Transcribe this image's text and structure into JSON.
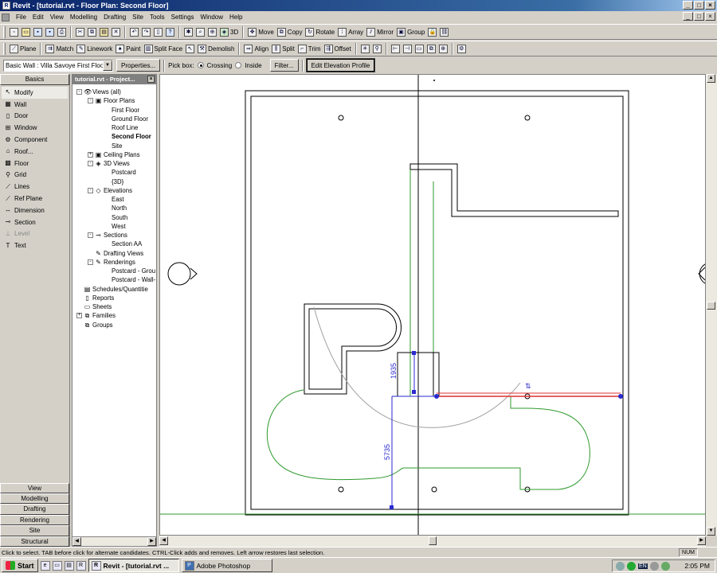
{
  "window": {
    "title": "Revit - [tutorial.rvt - Floor Plan: Second Floor]",
    "minimize": "_",
    "maximize": "□",
    "close": "×"
  },
  "menu": [
    "File",
    "Edit",
    "View",
    "Modelling",
    "Drafting",
    "Site",
    "Tools",
    "Settings",
    "Window",
    "Help"
  ],
  "toolbar1": [
    {
      "icon": "new-icon",
      "glyph": "▫"
    },
    {
      "icon": "open-icon",
      "glyph": "▭"
    },
    {
      "icon": "save-icon",
      "glyph": "▪"
    },
    {
      "icon": "save-as-icon",
      "glyph": "▪"
    },
    {
      "icon": "print-icon",
      "glyph": "⎙"
    },
    {
      "icon": "cut-icon",
      "glyph": "✂"
    },
    {
      "icon": "copy-icon",
      "glyph": "⧉"
    },
    {
      "icon": "paste-icon",
      "glyph": "▤"
    },
    {
      "icon": "delete-icon",
      "glyph": "✕"
    },
    {
      "icon": "undo-icon",
      "glyph": "↶"
    },
    {
      "icon": "redo-icon",
      "glyph": "↷"
    },
    {
      "icon": "thin-lines-icon",
      "glyph": "▯"
    },
    {
      "icon": "help-icon",
      "glyph": "?"
    },
    {
      "icon": "orbit-icon",
      "glyph": "✱"
    },
    {
      "icon": "zoom-icon",
      "glyph": "⌕"
    },
    {
      "icon": "zoom-region-icon",
      "glyph": "⊕"
    },
    {
      "icon": "3d-view-icon",
      "glyph": "◈"
    }
  ],
  "toolbar1_labels": {
    "threed": "3D",
    "move": "Move",
    "copy": "Copy",
    "rotate": "Rotate",
    "array": "Array",
    "mirror": "Mirror",
    "group": "Group"
  },
  "toolbar2": {
    "plane": "Plane",
    "match": "Match",
    "linework": "Linework",
    "paint": "Paint",
    "split_face": "Split Face",
    "demolish": "Demolish",
    "align": "Align",
    "split": "Split",
    "trim": "Trim",
    "offset": "Offset"
  },
  "options": {
    "type_selector": "Basic Wall : Villa Savoye First Floor",
    "properties": "Properties...",
    "pick_box": "Pick box:",
    "crossing": "Crossing",
    "inside": "Inside",
    "filter": "Filter...",
    "edit_profile": "Edit Elevation Profile"
  },
  "design_bar": {
    "title": "Basics",
    "items": [
      {
        "label": "Modify",
        "icon": "arrow-icon",
        "glyph": "↖",
        "selected": true
      },
      {
        "label": "Wall",
        "icon": "wall-icon",
        "glyph": "▦"
      },
      {
        "label": "Door",
        "icon": "door-icon",
        "glyph": "▯"
      },
      {
        "label": "Window",
        "icon": "window-icon",
        "glyph": "⊞"
      },
      {
        "label": "Component",
        "icon": "component-icon",
        "glyph": "⚙"
      },
      {
        "label": "Roof...",
        "icon": "roof-icon",
        "glyph": "⌂"
      },
      {
        "label": "Floor",
        "icon": "floor-icon",
        "glyph": "▩"
      },
      {
        "label": "Grid",
        "icon": "grid-icon",
        "glyph": "⚲"
      },
      {
        "label": "Lines",
        "icon": "lines-icon",
        "glyph": "⟋"
      },
      {
        "label": "Ref Plane",
        "icon": "ref-plane-icon",
        "glyph": "⟋"
      },
      {
        "label": "Dimension",
        "icon": "dimension-icon",
        "glyph": "↔"
      },
      {
        "label": "Section",
        "icon": "section-icon",
        "glyph": "⊸"
      },
      {
        "label": "Level",
        "icon": "level-icon",
        "glyph": "⊥",
        "disabled": true
      },
      {
        "label": "Text",
        "icon": "text-icon",
        "glyph": "T"
      }
    ],
    "tabs": [
      "View",
      "Modelling",
      "Drafting",
      "Rendering",
      "Site",
      "Structural"
    ]
  },
  "project_browser": {
    "title": "tutorial.rvt - Project...",
    "close": "×",
    "nodes": [
      {
        "label": "Views (all)",
        "level": 0,
        "expander": "-",
        "icon": "eye-icon",
        "glyph": "👁"
      },
      {
        "label": "Floor Plans",
        "level": 1,
        "expander": "-",
        "icon": "floor-plan-icon",
        "glyph": "▣"
      },
      {
        "label": "First Floor",
        "level": 2
      },
      {
        "label": "Ground Floor",
        "level": 2
      },
      {
        "label": "Roof Line",
        "level": 2
      },
      {
        "label": "Second Floor",
        "level": 2,
        "bold": true
      },
      {
        "label": "Site",
        "level": 2
      },
      {
        "label": "Ceiling Plans",
        "level": 1,
        "expander": "+",
        "icon": "ceiling-plan-icon",
        "glyph": "▣"
      },
      {
        "label": "3D Views",
        "level": 1,
        "expander": "-",
        "icon": "3d-views-icon",
        "glyph": "◈"
      },
      {
        "label": "Postcard",
        "level": 2
      },
      {
        "label": "{3D}",
        "level": 2
      },
      {
        "label": "Elevations",
        "level": 1,
        "expander": "-",
        "icon": "elevation-icon",
        "glyph": "◇"
      },
      {
        "label": "East",
        "level": 2
      },
      {
        "label": "North",
        "level": 2
      },
      {
        "label": "South",
        "level": 2
      },
      {
        "label": "West",
        "level": 2
      },
      {
        "label": "Sections",
        "level": 1,
        "expander": "-",
        "icon": "sections-icon",
        "glyph": "⊸"
      },
      {
        "label": "Section AA",
        "level": 2
      },
      {
        "label": "Drafting Views",
        "level": 1,
        "icon": "drafting-icon",
        "glyph": "✎"
      },
      {
        "label": "Renderings",
        "level": 1,
        "expander": "-",
        "icon": "renderings-icon",
        "glyph": "✎"
      },
      {
        "label": "Postcard - Grou",
        "level": 2
      },
      {
        "label": "Postcard - Wall-",
        "level": 2
      },
      {
        "label": "Schedules/Quantitie",
        "level": 0,
        "icon": "schedule-icon",
        "glyph": "▤"
      },
      {
        "label": "Reports",
        "level": 0,
        "icon": "reports-icon",
        "glyph": "▯"
      },
      {
        "label": "Sheets",
        "level": 0,
        "icon": "sheets-icon",
        "glyph": "▭"
      },
      {
        "label": "Families",
        "level": 0,
        "expander": "+",
        "icon": "families-icon",
        "glyph": "⧉"
      },
      {
        "label": "Groups",
        "level": 0,
        "icon": "groups-icon",
        "glyph": "⧉"
      }
    ]
  },
  "canvas": {
    "dim_vertical_1": "1935",
    "dim_vertical_2": "5735",
    "accent_green": "#2e9a2e",
    "accent_red": "#e03030",
    "accent_blue": "#2a2ad0"
  },
  "status": {
    "text": "Click to select. TAB before click for alternate candidates. CTRL-Click adds and removes. Left arrow restores last selection.",
    "num": "NUM"
  },
  "taskbar": {
    "start": "Start",
    "tasks": [
      {
        "label": "Revit - [tutorial.rvt ...",
        "active": true
      },
      {
        "label": "Adobe Photoshop",
        "active": false
      }
    ],
    "lang": "EN",
    "clock": "2:05 PM"
  }
}
